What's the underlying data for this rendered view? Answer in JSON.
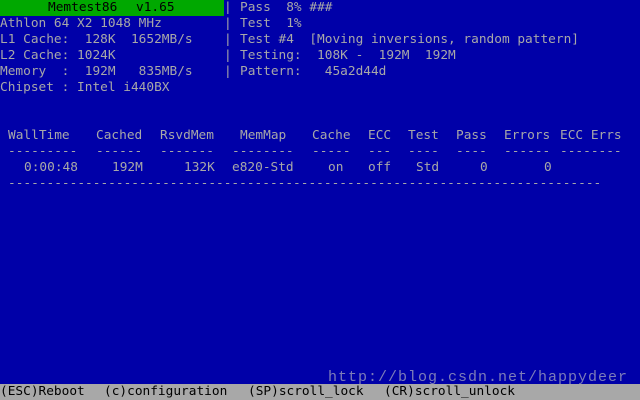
{
  "title": {
    "name": "Memtest86",
    "version": "v1.65"
  },
  "info": {
    "cpu": "Athlon 64 X2 1048 MHz",
    "l1": "L1 Cache:  128K  1652MB/s",
    "l2": "L2 Cache: 1024K",
    "memory": "Memory  :  192M   835MB/s",
    "chipset": "Chipset : Intel i440BX"
  },
  "separator": "|",
  "status": {
    "pass_label": "Pass  8%",
    "pass_bar": "###",
    "test_label": "Test  1%",
    "test_name": "Test #4  [Moving inversions, random pattern]",
    "testing": "Testing:  108K -  192M  192M",
    "pattern": "Pattern:   45a2d44d"
  },
  "table": {
    "headers": [
      "WallTime",
      "Cached",
      "RsvdMem",
      "MemMap",
      "Cache",
      "ECC",
      "Test",
      "Pass",
      "Errors",
      "ECC Errs"
    ],
    "dashes": [
      "---------",
      "------",
      "-------",
      "--------",
      "-----",
      "---",
      "----",
      "----",
      "------",
      "--------"
    ],
    "values": [
      "0:00:48",
      "192M",
      "132K",
      "e820-Std",
      "on",
      "off",
      "Std",
      "0",
      "0"
    ],
    "long_dash": "-----------------------------------------------------------------------------"
  },
  "watermark": "http://blog.csdn.net/happydeer",
  "footer": {
    "reboot": "(ESC)Reboot",
    "config": "(c)configuration",
    "scroll_lock": "(SP)scroll_lock",
    "scroll_unlock": "(CR)scroll_unlock"
  },
  "colors": {
    "background": "#0000a8",
    "text": "#a8a8a8",
    "title_bar": "#00a800",
    "footer_bar": "#a8a8a8"
  }
}
